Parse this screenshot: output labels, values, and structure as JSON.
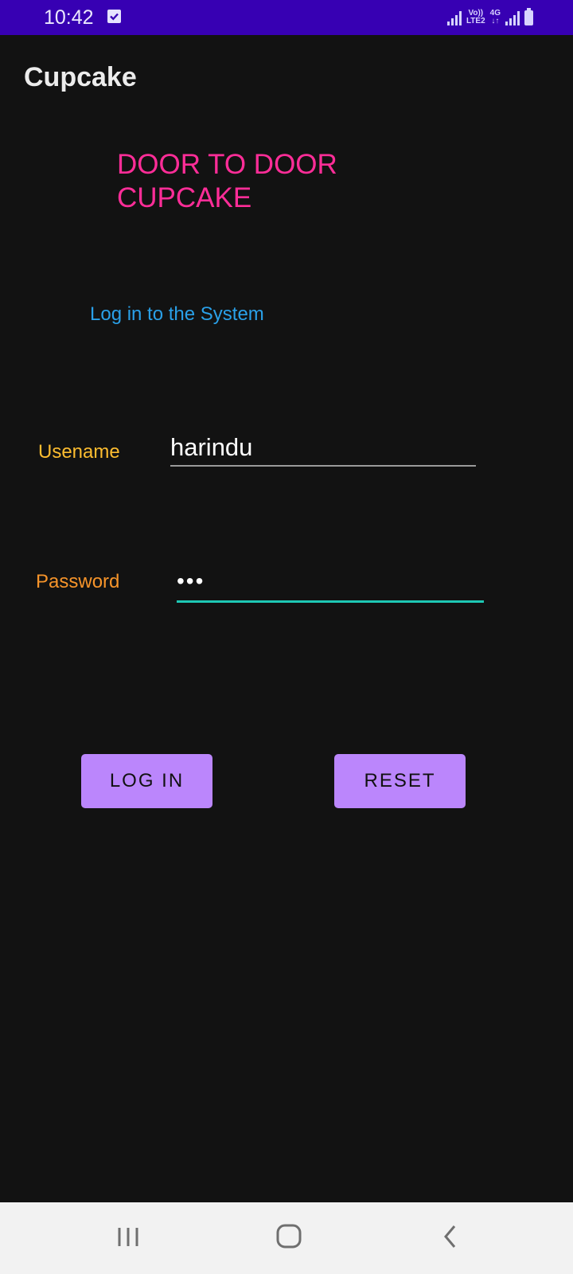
{
  "status_bar": {
    "time": "10:42",
    "network_top": "Vo))",
    "network_bottom": "LTE2",
    "network_4g": "4G",
    "network_arrows": "↓↑"
  },
  "app": {
    "title": "Cupcake"
  },
  "login_screen": {
    "headline_line1": "DOOR TO DOOR",
    "headline_line2": "CUPCAKE",
    "subtitle": "Log in to the System",
    "username_label": "Usename",
    "username_value": "harindu",
    "password_label": "Password",
    "password_value": "abc",
    "login_button": "LOG IN",
    "reset_button": "RESET"
  },
  "colors": {
    "background": "#121212",
    "status_bar": "#3700b3",
    "headline": "#ff2d98",
    "subtitle": "#2aa0e8",
    "username_label": "#fdbd30",
    "password_label": "#f6942a",
    "button": "#bb86fc",
    "focused_underline": "#1ec8b4"
  },
  "icons": {
    "status_notification": "checkbox-notification-icon",
    "signal": "signal-strength-icon",
    "battery": "battery-icon",
    "recent_apps": "recent-apps-icon",
    "home": "home-icon",
    "back": "back-icon"
  }
}
